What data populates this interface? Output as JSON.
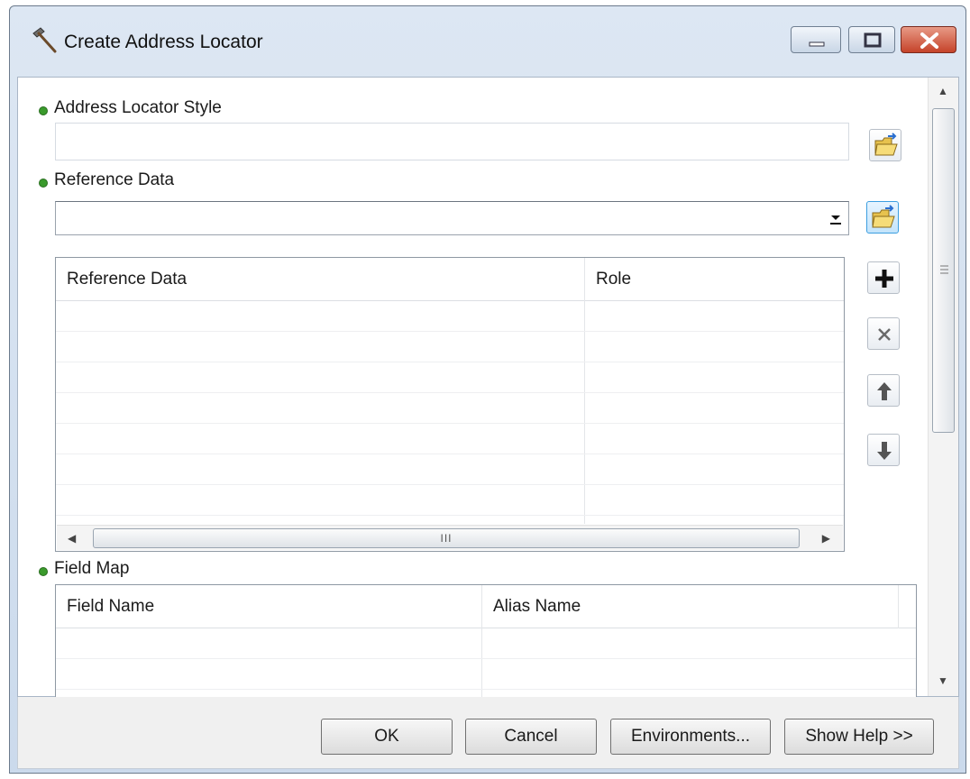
{
  "window": {
    "title": "Create Address Locator"
  },
  "fields": {
    "locator_style": {
      "label": "Address Locator Style",
      "value": ""
    },
    "reference_data": {
      "label": "Reference Data",
      "value": ""
    },
    "field_map": {
      "label": "Field Map"
    }
  },
  "reference_table": {
    "columns": [
      "Reference Data",
      "Role"
    ],
    "rows": [],
    "scroll_grip": "III"
  },
  "field_map_table": {
    "columns": [
      "Field Name",
      "Alias Name"
    ],
    "rows": []
  },
  "buttons": {
    "ok": "OK",
    "cancel": "Cancel",
    "environments": "Environments...",
    "show_help": "Show Help >>"
  },
  "icons": {
    "app": "hammer-icon",
    "browse": "open-folder-icon",
    "add": "plus-icon",
    "remove": "x-icon",
    "up": "arrow-up-icon",
    "down": "arrow-down-icon"
  },
  "colors": {
    "required_dot": "#3a9a2c",
    "active_button": "#3c9ee0",
    "close_button": "#c5432a"
  }
}
